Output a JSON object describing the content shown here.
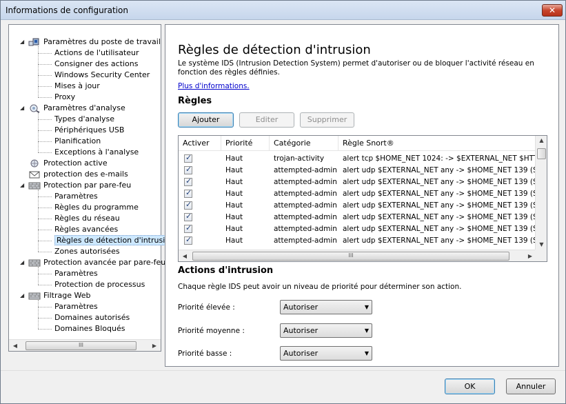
{
  "window": {
    "title": "Informations de configuration",
    "close_glyph": "✕"
  },
  "tree": {
    "items": [
      {
        "label": "Paramètres du poste de travail",
        "level": 0,
        "expanded": true,
        "icon": "workstation-icon"
      },
      {
        "label": "Actions de l'utilisateur",
        "level": 1
      },
      {
        "label": "Consigner des actions",
        "level": 1
      },
      {
        "label": "Windows Security Center",
        "level": 1
      },
      {
        "label": "Mises à jour",
        "level": 1
      },
      {
        "label": "Proxy",
        "level": 1
      },
      {
        "label": "Paramètres d'analyse",
        "level": 0,
        "expanded": true,
        "icon": "scan-icon"
      },
      {
        "label": "Types d'analyse",
        "level": 1
      },
      {
        "label": "Périphériques USB",
        "level": 1
      },
      {
        "label": "Planification",
        "level": 1
      },
      {
        "label": "Exceptions à l'analyse",
        "level": 1
      },
      {
        "label": "Protection active",
        "level": 0,
        "icon": "active-protection-icon"
      },
      {
        "label": "protection des e-mails",
        "level": 0,
        "icon": "email-icon"
      },
      {
        "label": "Protection par pare-feu",
        "level": 0,
        "expanded": true,
        "icon": "firewall-icon"
      },
      {
        "label": "Paramètres",
        "level": 1
      },
      {
        "label": "Règles du programme",
        "level": 1
      },
      {
        "label": "Règles du réseau",
        "level": 1
      },
      {
        "label": "Règles avancées",
        "level": 1
      },
      {
        "label": "Règles de détection d'intrusion",
        "level": 1,
        "selected": true
      },
      {
        "label": "Zones autorisées",
        "level": 1
      },
      {
        "label": "Protection avancée par pare-feu",
        "level": 0,
        "expanded": true,
        "icon": "firewall-icon"
      },
      {
        "label": "Paramètres",
        "level": 1
      },
      {
        "label": "Protection de processus",
        "level": 1
      },
      {
        "label": "Filtrage Web",
        "level": 0,
        "expanded": true,
        "icon": "web-filter-icon"
      },
      {
        "label": "Paramètres",
        "level": 1
      },
      {
        "label": "Domaines autorisés",
        "level": 1
      },
      {
        "label": "Domaines Bloqués",
        "level": 1
      }
    ],
    "scroll_thumb": "III"
  },
  "content": {
    "title": "Règles de détection d'intrusion",
    "description": "Le système IDS (Intrusion Detection System) permet d'autoriser ou de bloquer l'activité réseau en fonction des règles définies.",
    "more_info_link": "Plus d'informations.",
    "rules_section": "Règles",
    "buttons": {
      "add": "Ajouter",
      "edit": "Editer",
      "delete": "Supprimer"
    },
    "columns": [
      "Activer",
      "Priorité",
      "Catégorie",
      "Règle Snort®"
    ],
    "rows": [
      {
        "priority": "Haut",
        "category": "trojan-activity",
        "rule": "alert tcp $HOME_NET 1024: -> $EXTERNAL_NET $HTT..."
      },
      {
        "priority": "Haut",
        "category": "attempted-admin",
        "rule": "alert udp $EXTERNAL_NET any -> $HOME_NET 139 (SB"
      },
      {
        "priority": "Haut",
        "category": "attempted-admin",
        "rule": "alert udp $EXTERNAL_NET any -> $HOME_NET 139 (SB"
      },
      {
        "priority": "Haut",
        "category": "attempted-admin",
        "rule": "alert udp $EXTERNAL_NET any -> $HOME_NET 139 (SB"
      },
      {
        "priority": "Haut",
        "category": "attempted-admin",
        "rule": "alert udp $EXTERNAL_NET any -> $HOME_NET 139 (SB"
      },
      {
        "priority": "Haut",
        "category": "attempted-admin",
        "rule": "alert udp $EXTERNAL_NET any -> $HOME_NET 139 (SB"
      },
      {
        "priority": "Haut",
        "category": "attempted-admin",
        "rule": "alert udp $EXTERNAL_NET any -> $HOME_NET 139 (SB"
      },
      {
        "priority": "Haut",
        "category": "attempted-admin",
        "rule": "alert udp $EXTERNAL_NET any -> $HOME_NET 139 (SB"
      }
    ],
    "grid_scroll_thumb": "III",
    "actions_section": "Actions d'intrusion",
    "actions_description": "Chaque règle IDS peut avoir un niveau de priorité pour déterminer son action.",
    "priorities": [
      {
        "label": "Priorité élevée :",
        "value": "Autoriser"
      },
      {
        "label": "Priorité moyenne :",
        "value": "Autoriser"
      },
      {
        "label": "Priorité basse :",
        "value": "Autoriser"
      }
    ]
  },
  "footer": {
    "ok": "OK",
    "cancel": "Annuler"
  }
}
